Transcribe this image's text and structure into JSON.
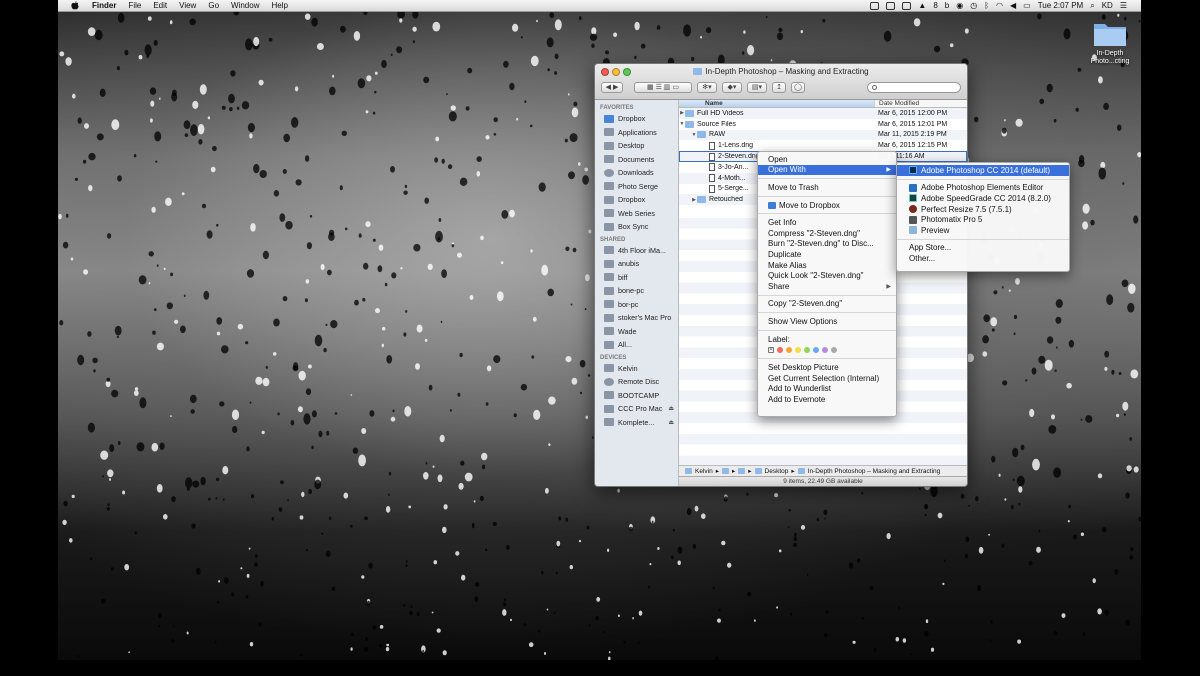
{
  "menubar": {
    "app_name": "Finder",
    "items": [
      "File",
      "Edit",
      "View",
      "Go",
      "Window",
      "Help"
    ],
    "status_number": "8",
    "clock": "Tue 2:07 PM",
    "user": "KD"
  },
  "desktop_icon": {
    "label": "In-Depth Photo...cting"
  },
  "finder": {
    "title": "In-Depth Photoshop – Masking and Extracting",
    "sidebar": {
      "favorites_header": "FAVORITES",
      "favorites": [
        "Dropbox",
        "Applications",
        "Desktop",
        "Documents",
        "Downloads",
        "Photo Serge",
        "Dropbox",
        "Web Series",
        "Box Sync"
      ],
      "shared_header": "SHARED",
      "shared": [
        "4th Floor iMa...",
        "anubis",
        "biff",
        "bone-pc",
        "bor-pc",
        "stoker's Mac Pro",
        "Wade",
        "All..."
      ],
      "devices_header": "DEVICES",
      "devices": [
        "Kelvin",
        "Remote Disc",
        "BOOTCAMP",
        "CCC Pro Mac",
        "Komplete..."
      ]
    },
    "columns": {
      "name": "Name",
      "date": "Date Modified"
    },
    "rows": [
      {
        "name": "Full HD Videos",
        "date": "Mar 6, 2015 12:00 PM"
      },
      {
        "name": "Source Files",
        "date": "Mar 6, 2015 12:01 PM"
      },
      {
        "name": "RAW",
        "date": "Mar 11, 2015 2:19 PM"
      },
      {
        "name": "1-Lens.dng",
        "date": "Mar 6, 2015 12:15 PM"
      },
      {
        "name": "2-Steven.dng",
        "date": "2015 11:16 AM"
      },
      {
        "name": "3-Jo-An...",
        "date": ""
      },
      {
        "name": "4-Moth...",
        "date": ""
      },
      {
        "name": "5-Serge...",
        "date": ""
      },
      {
        "name": "Retouched",
        "date": ""
      }
    ],
    "pathbar": [
      "Kelvin",
      "Desktop",
      "In-Depth Photoshop – Masking and Extracting"
    ],
    "status": "9 items, 22.49 GB available"
  },
  "context_menu": {
    "group1": [
      "Open",
      "Open With"
    ],
    "group2": [
      "Move to Trash"
    ],
    "group3": [
      "Move to Dropbox"
    ],
    "group4": [
      "Get Info",
      "Compress \"2-Steven.dng\"",
      "Burn \"2-Steven.dng\" to Disc...",
      "Duplicate",
      "Make Alias",
      "Quick Look \"2-Steven.dng\"",
      "Share"
    ],
    "group5": [
      "Copy \"2-Steven.dng\""
    ],
    "group6": [
      "Show View Options"
    ],
    "label_title": "Label:",
    "group7": [
      "Set Desktop Picture",
      "Get Current Selection (Internal)",
      "Add to Wunderlist",
      "Add to Evernote"
    ]
  },
  "open_with_menu": {
    "default_app": "Adobe Photoshop CC 2014 (default)",
    "apps": [
      "Adobe Photoshop Elements Editor",
      "Adobe SpeedGrade CC 2014 (8.2.0)",
      "Perfect Resize 7.5 (7.5.1)",
      "Photomatix Pro 5",
      "Preview"
    ],
    "extra": [
      "App Store...",
      "Other..."
    ]
  },
  "colors": {
    "highlight": "#3a70dc",
    "label_colors": [
      "#f06a5e",
      "#f7a33c",
      "#f4de4a",
      "#8fd65a",
      "#6aa8f0",
      "#b38be0",
      "#a9a9a9"
    ]
  }
}
